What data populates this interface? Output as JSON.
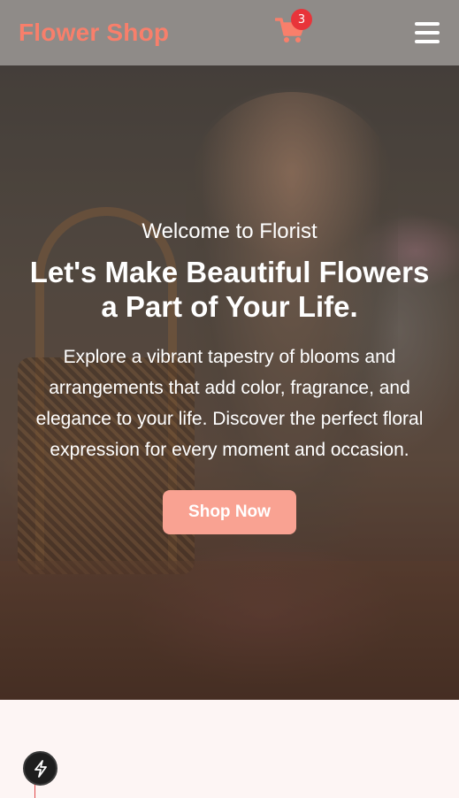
{
  "header": {
    "logo": "Flower Shop",
    "cart_count": "3",
    "cart_icon": "shopping-cart-icon",
    "menu_icon": "hamburger-menu-icon"
  },
  "hero": {
    "welcome": "Welcome to Florist",
    "headline": "Let's Make Beautiful Flowers a Part of Your Life.",
    "description": "Explore a vibrant tapestry of blooms and arrangements that add color, fragrance, and elegance to your life. Discover the perfect floral expression for every moment and occasion.",
    "cta_label": "Shop Now"
  },
  "colors": {
    "brand": "#f87f6b",
    "button": "#f9a292",
    "badge": "#e8343a",
    "section_bg": "#fdf5f4"
  },
  "floating": {
    "icon": "lightning-bolt-icon"
  }
}
